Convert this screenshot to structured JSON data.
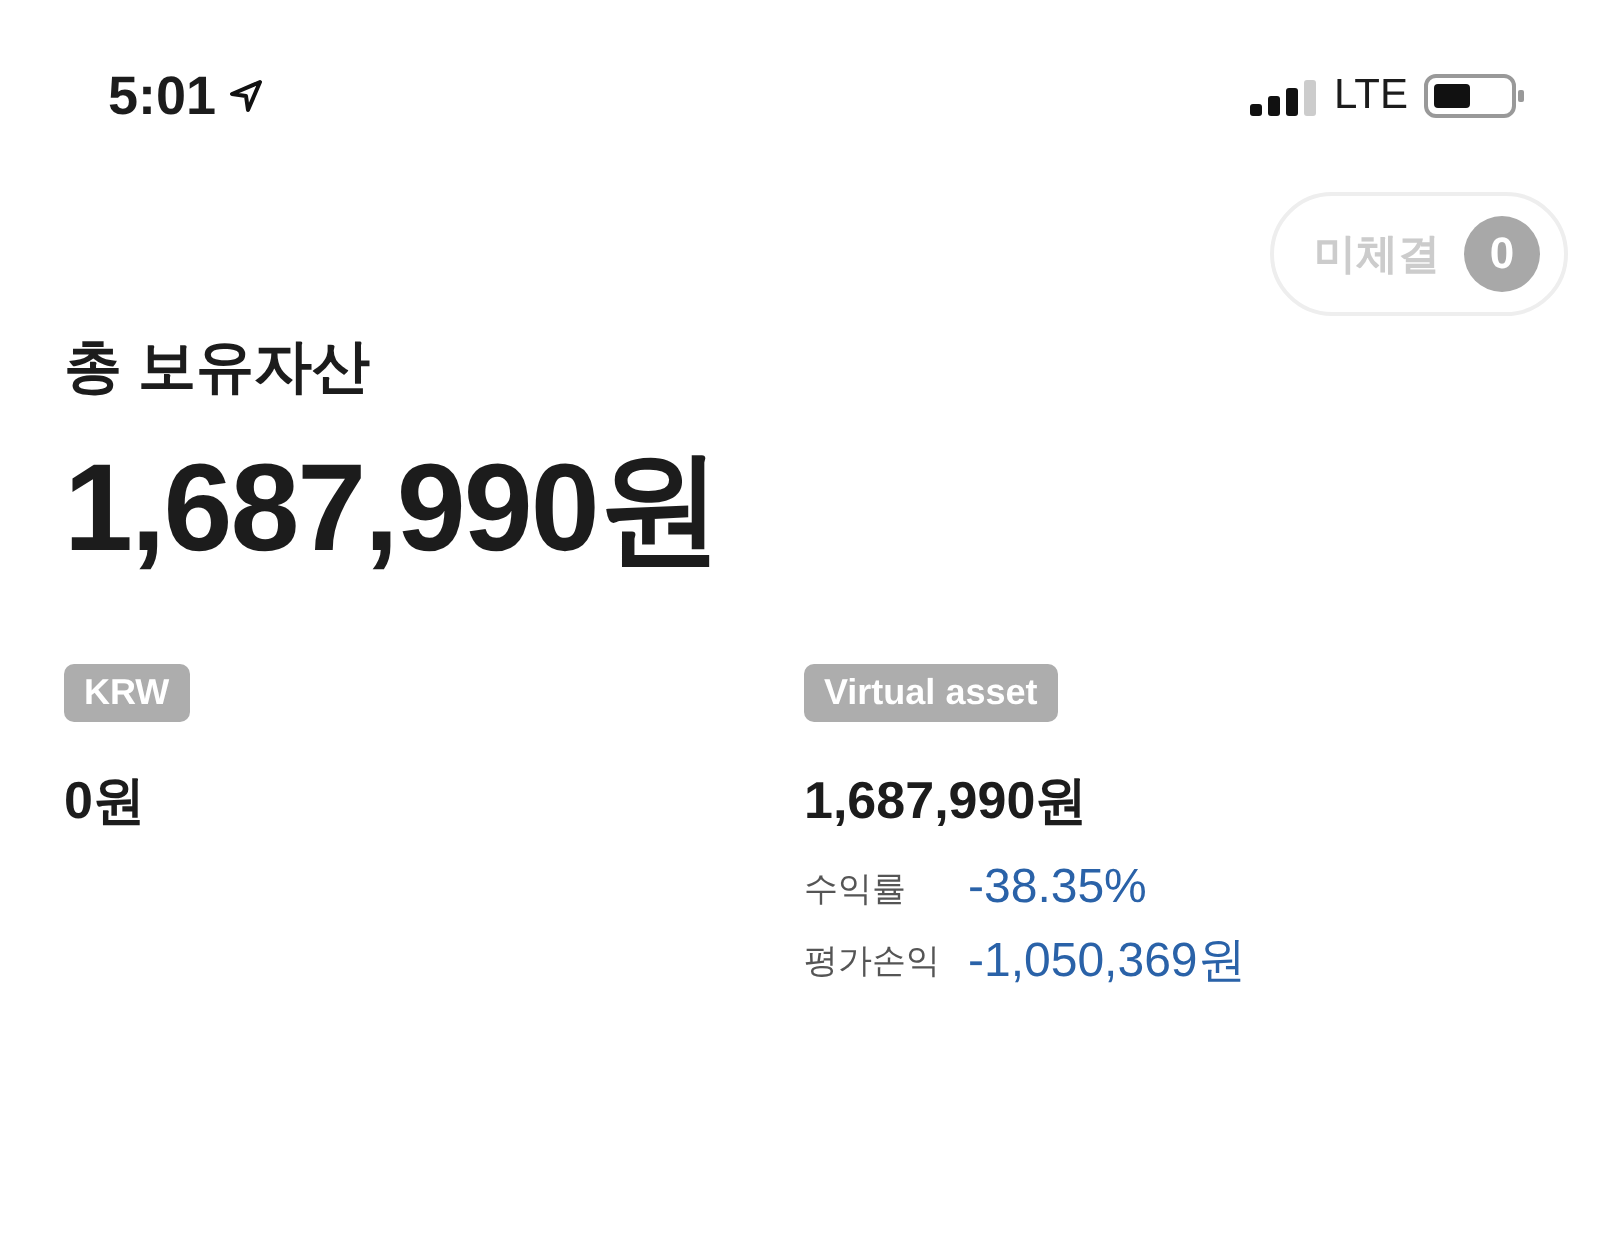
{
  "status_bar": {
    "time": "5:01",
    "network": "LTE"
  },
  "pending": {
    "label": "미체결",
    "count": "0"
  },
  "total": {
    "title": "총 보유자산",
    "amount": "1,687,990원"
  },
  "accounts": [
    {
      "badge": "KRW",
      "amount": "0원"
    },
    {
      "badge": "Virtual asset",
      "amount": "1,687,990원",
      "metrics": [
        {
          "label": "수익률",
          "value": "-38.35%"
        },
        {
          "label": "평가손익",
          "value": "-1,050,369원"
        }
      ]
    }
  ]
}
